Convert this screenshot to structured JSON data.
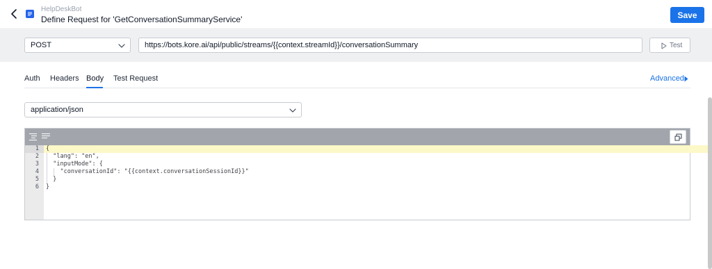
{
  "header": {
    "bot_name": "HelpDeskBot",
    "title": "Define Request for 'GetConversationSummaryService'",
    "save_label": "Save"
  },
  "request": {
    "method": "POST",
    "url": "https://bots.kore.ai/api/public/streams/{{context.streamId}}/conversationSummary",
    "test_label": "Test"
  },
  "tabs": [
    {
      "label": "Auth",
      "active": false
    },
    {
      "label": "Headers",
      "active": false
    },
    {
      "label": "Body",
      "active": true
    },
    {
      "label": "Test Request",
      "active": false
    }
  ],
  "advanced_label": "Advanced",
  "body": {
    "content_type": "application/json"
  },
  "editor": {
    "line_numbers": [
      "1",
      "2",
      "3",
      "4",
      "5",
      "6"
    ],
    "lines": [
      "{",
      "  \"lang\": \"en\",",
      "  \"inputMode\": {",
      "    \"conversationId\": \"{{context.conversationSessionId}}\"",
      "  }",
      "}"
    ]
  },
  "colors": {
    "accent": "#1a73e8",
    "request_bar_bg": "#eff0f2",
    "editor_toolbar_bg": "#a2a6ac",
    "active_line_bg": "#fdf8c8"
  },
  "icons": {
    "back": "chevron-left-icon",
    "bot": "bot-icon",
    "test": "play-icon",
    "advanced": "caret-right-icon",
    "format": "format-align-icon",
    "compact": "compact-lines-icon",
    "expand": "expand-icon"
  }
}
